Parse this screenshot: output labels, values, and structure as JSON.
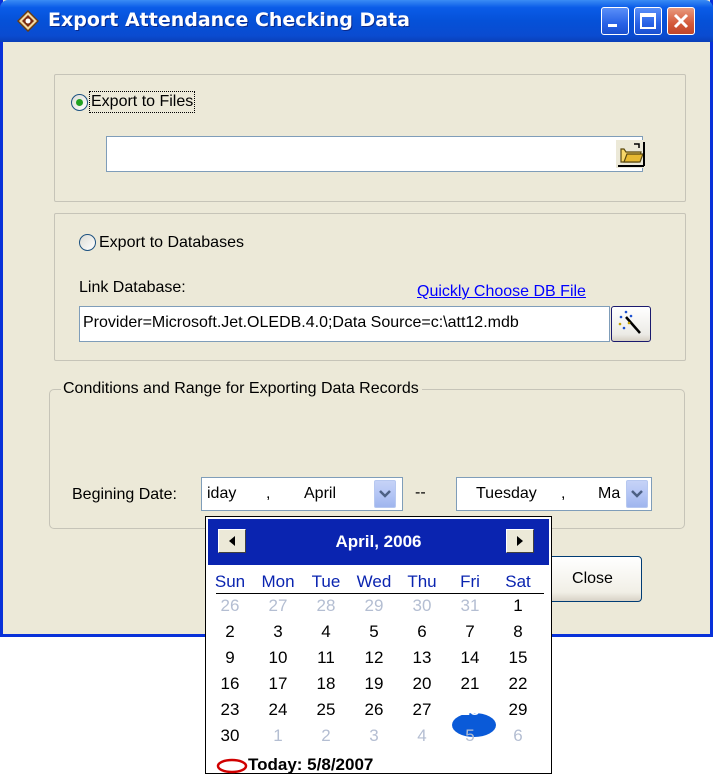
{
  "window": {
    "title": "Export Attendance Checking Data"
  },
  "export_files": {
    "radio_label": "Export to Files",
    "selected": true,
    "path_value": ""
  },
  "export_db": {
    "radio_label": "Export to Databases",
    "selected": false,
    "link_label": "Link Database:",
    "quick_link": "Quickly Choose DB File",
    "connection_value": "Provider=Microsoft.Jet.OLEDB.4.0;Data Source=c:\\att12.mdb"
  },
  "conditions": {
    "legend": "Conditions and Range for Exporting Data Records",
    "begin_label": "Begining Date:",
    "begin_weekday": "iday",
    "begin_sep": ",",
    "begin_month": "April",
    "range_sep": "--",
    "end_weekday": "Tuesday",
    "end_sep": ",",
    "end_month": "Ma"
  },
  "buttons": {
    "close_label": "Close"
  },
  "calendar": {
    "title": "April, 2006",
    "weekdays": [
      "Sun",
      "Mon",
      "Tue",
      "Wed",
      "Thu",
      "Fri",
      "Sat"
    ],
    "weeks": [
      [
        "26",
        "27",
        "28",
        "29",
        "30",
        "31",
        "1"
      ],
      [
        "2",
        "3",
        "4",
        "5",
        "6",
        "7",
        "8"
      ],
      [
        "9",
        "10",
        "11",
        "12",
        "13",
        "14",
        "15"
      ],
      [
        "16",
        "17",
        "18",
        "19",
        "20",
        "21",
        "22"
      ],
      [
        "23",
        "24",
        "25",
        "26",
        "27",
        "28",
        "29"
      ],
      [
        "30",
        "1",
        "2",
        "3",
        "4",
        "5",
        "6"
      ]
    ],
    "selected_day": "28",
    "today_label": "Today: 5/8/2007"
  },
  "colors": {
    "titlebar": "#0a5ce8",
    "calendar_header": "#0a24b0",
    "link": "#0000ff",
    "selected_day": "#0a5ad8"
  }
}
